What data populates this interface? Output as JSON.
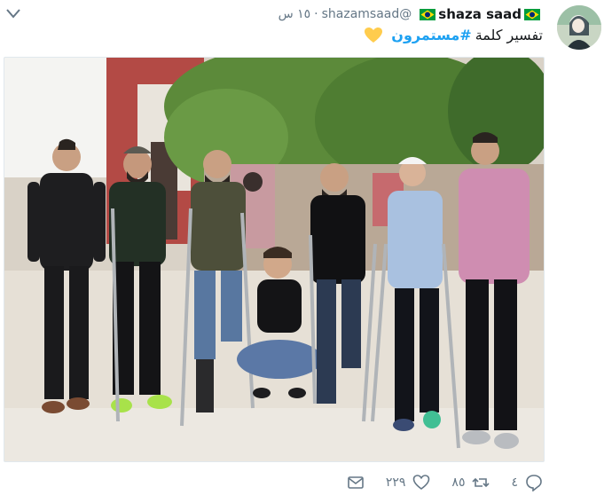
{
  "user": {
    "display_name": "shaza saad",
    "handle": "@shazamsaad",
    "time": "١٥ س",
    "separator": "·",
    "flag_icon": "brazil-flag-icon",
    "avatar_icon": "profile-avatar"
  },
  "tweet": {
    "text_before": "تفسير كلمة",
    "hashtag": "#مستمرون",
    "emoji_icon": "yellow-heart-icon"
  },
  "actions": {
    "reply_count": "٤",
    "retweet_count": "٨٥",
    "like_count": "٢٢٩",
    "reply_icon": "reply-icon",
    "retweet_icon": "retweet-icon",
    "like_icon": "heart-outline-icon",
    "dm_icon": "envelope-icon"
  },
  "colors": {
    "link": "#1da1f2",
    "muted": "#657786",
    "heart": "#ffcc4d"
  }
}
